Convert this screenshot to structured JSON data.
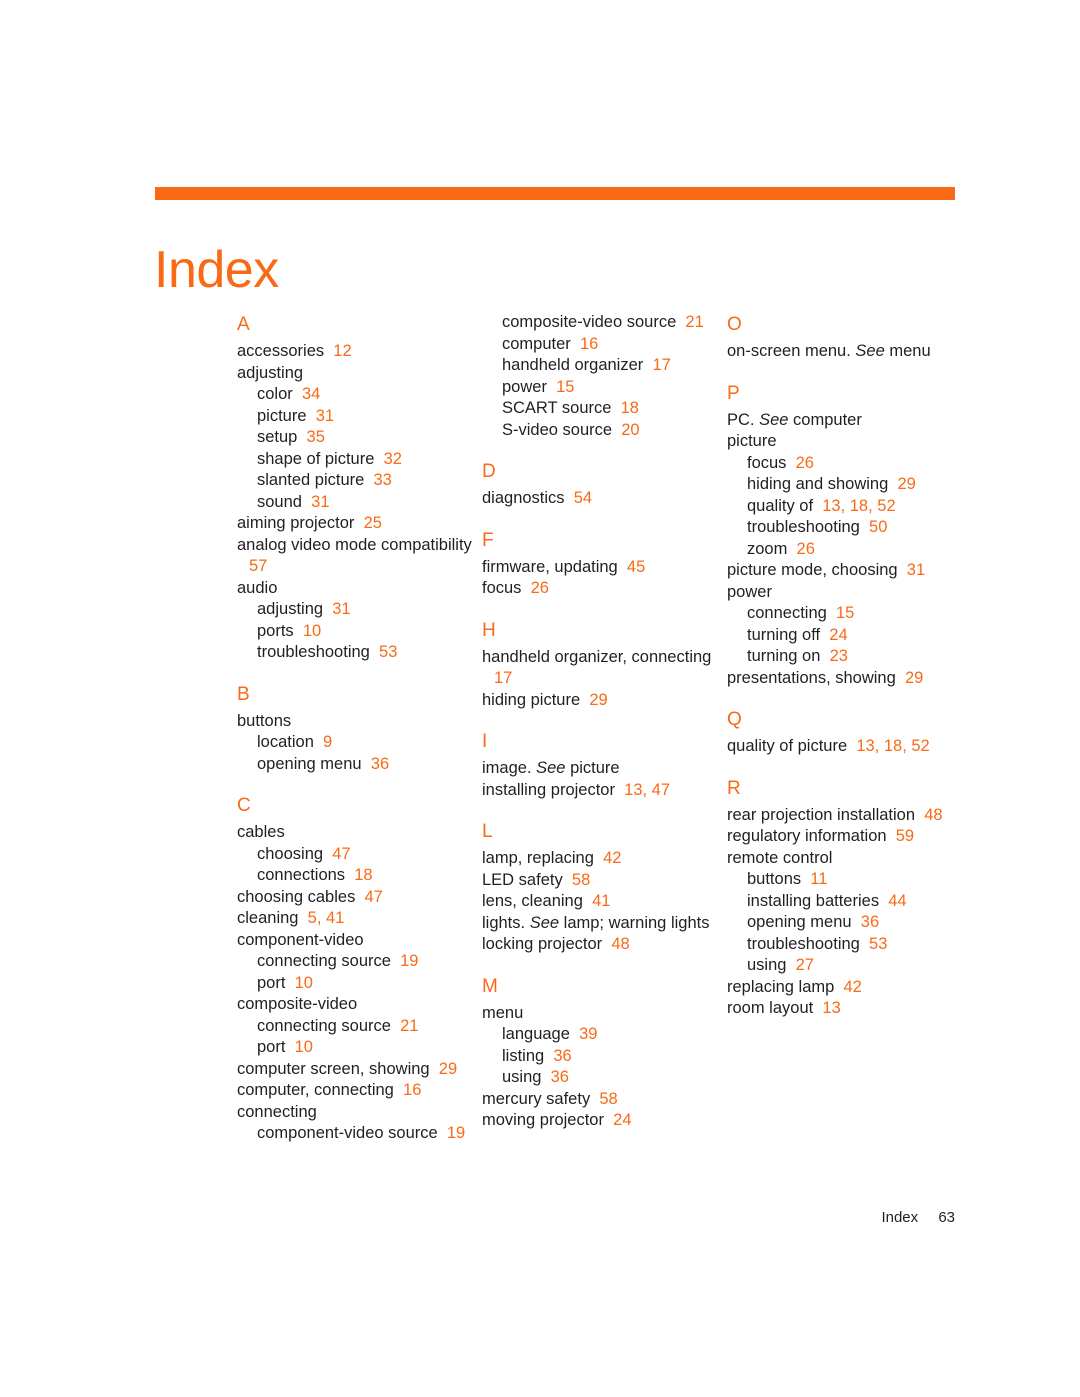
{
  "document": {
    "title": "Index",
    "accent_color": "#f96a16",
    "text_color": "#231f20",
    "footer": {
      "label": "Index",
      "page_number": "63"
    }
  },
  "columns": [
    {
      "id": "column-1",
      "blocks": [
        {
          "letter": "A",
          "entries": [
            {
              "level": 0,
              "text": "accessories",
              "pages": "12"
            },
            {
              "level": 0,
              "text": "adjusting",
              "pages": ""
            },
            {
              "level": 1,
              "text": "color",
              "pages": "34"
            },
            {
              "level": 1,
              "text": "picture",
              "pages": "31"
            },
            {
              "level": 1,
              "text": "setup",
              "pages": "35"
            },
            {
              "level": 1,
              "text": "shape of picture",
              "pages": "32"
            },
            {
              "level": 1,
              "text": "slanted picture",
              "pages": "33"
            },
            {
              "level": 1,
              "text": "sound",
              "pages": "31"
            },
            {
              "level": 0,
              "text": "aiming projector",
              "pages": "25"
            },
            {
              "level": 0,
              "text": "analog video mode compatibility",
              "pages": "57"
            },
            {
              "level": 0,
              "text": "audio",
              "pages": ""
            },
            {
              "level": 1,
              "text": "adjusting",
              "pages": "31"
            },
            {
              "level": 1,
              "text": "ports",
              "pages": "10"
            },
            {
              "level": 1,
              "text": "troubleshooting",
              "pages": "53"
            }
          ]
        },
        {
          "letter": "B",
          "entries": [
            {
              "level": 0,
              "text": "buttons",
              "pages": ""
            },
            {
              "level": 1,
              "text": "location",
              "pages": "9"
            },
            {
              "level": 1,
              "text": "opening menu",
              "pages": "36"
            }
          ]
        },
        {
          "letter": "C",
          "entries": [
            {
              "level": 0,
              "text": "cables",
              "pages": ""
            },
            {
              "level": 1,
              "text": "choosing",
              "pages": "47"
            },
            {
              "level": 1,
              "text": "connections",
              "pages": "18"
            },
            {
              "level": 0,
              "text": "choosing cables",
              "pages": "47"
            },
            {
              "level": 0,
              "text": "cleaning",
              "pages": "5, 41"
            },
            {
              "level": 0,
              "text": "component-video",
              "pages": ""
            },
            {
              "level": 1,
              "text": "connecting source",
              "pages": "19"
            },
            {
              "level": 1,
              "text": "port",
              "pages": "10"
            },
            {
              "level": 0,
              "text": "composite-video",
              "pages": ""
            },
            {
              "level": 1,
              "text": "connecting source",
              "pages": "21"
            },
            {
              "level": 1,
              "text": "port",
              "pages": "10"
            },
            {
              "level": 0,
              "text": "computer screen, showing",
              "pages": "29"
            },
            {
              "level": 0,
              "text": "computer, connecting",
              "pages": "16"
            },
            {
              "level": 0,
              "text": "connecting",
              "pages": ""
            },
            {
              "level": 1,
              "text": "component-video source",
              "pages": "19"
            }
          ]
        }
      ]
    },
    {
      "id": "column-2",
      "blocks": [
        {
          "letter": "",
          "entries": [
            {
              "level": 1,
              "text": "composite-video source",
              "pages": "21"
            },
            {
              "level": 1,
              "text": "computer",
              "pages": "16"
            },
            {
              "level": 1,
              "text": "handheld organizer",
              "pages": "17"
            },
            {
              "level": 1,
              "text": "power",
              "pages": "15"
            },
            {
              "level": 1,
              "text": "SCART source",
              "pages": "18"
            },
            {
              "level": 1,
              "text": "S-video source",
              "pages": "20"
            }
          ]
        },
        {
          "letter": "D",
          "entries": [
            {
              "level": 0,
              "text": "diagnostics",
              "pages": "54"
            }
          ]
        },
        {
          "letter": "F",
          "entries": [
            {
              "level": 0,
              "text": "firmware, updating",
              "pages": "45"
            },
            {
              "level": 0,
              "text": "focus",
              "pages": "26"
            }
          ]
        },
        {
          "letter": "H",
          "entries": [
            {
              "level": 0,
              "text": "handheld organizer, connecting",
              "pages": "17"
            },
            {
              "level": 0,
              "text": "hiding picture",
              "pages": "29"
            }
          ]
        },
        {
          "letter": "I",
          "entries": [
            {
              "level": 0,
              "text": "image.",
              "see": "See",
              "after_see": "picture",
              "pages": ""
            },
            {
              "level": 0,
              "text": "installing projector",
              "pages": "13, 47"
            }
          ]
        },
        {
          "letter": "L",
          "entries": [
            {
              "level": 0,
              "text": "lamp, replacing",
              "pages": "42"
            },
            {
              "level": 0,
              "text": "LED safety",
              "pages": "58"
            },
            {
              "level": 0,
              "text": "lens, cleaning",
              "pages": "41"
            },
            {
              "level": 0,
              "text": "lights.",
              "see": "See",
              "after_see": "lamp; warning lights",
              "pages": ""
            },
            {
              "level": 0,
              "text": "locking projector",
              "pages": "48"
            }
          ]
        },
        {
          "letter": "M",
          "entries": [
            {
              "level": 0,
              "text": "menu",
              "pages": ""
            },
            {
              "level": 1,
              "text": "language",
              "pages": "39"
            },
            {
              "level": 1,
              "text": "listing",
              "pages": "36"
            },
            {
              "level": 1,
              "text": "using",
              "pages": "36"
            },
            {
              "level": 0,
              "text": "mercury safety",
              "pages": "58"
            },
            {
              "level": 0,
              "text": "moving projector",
              "pages": "24"
            }
          ]
        }
      ]
    },
    {
      "id": "column-3",
      "blocks": [
        {
          "letter": "O",
          "entries": [
            {
              "level": 0,
              "text": "on-screen menu.",
              "see": "See",
              "after_see": "menu",
              "pages": ""
            }
          ]
        },
        {
          "letter": "P",
          "entries": [
            {
              "level": 0,
              "text": "PC.",
              "see": "See",
              "after_see": "computer",
              "pages": ""
            },
            {
              "level": 0,
              "text": "picture",
              "pages": ""
            },
            {
              "level": 1,
              "text": "focus",
              "pages": "26"
            },
            {
              "level": 1,
              "text": "hiding and showing",
              "pages": "29"
            },
            {
              "level": 1,
              "text": "quality of",
              "pages": "13, 18, 52"
            },
            {
              "level": 1,
              "text": "troubleshooting",
              "pages": "50"
            },
            {
              "level": 1,
              "text": "zoom",
              "pages": "26"
            },
            {
              "level": 0,
              "text": "picture mode, choosing",
              "pages": "31"
            },
            {
              "level": 0,
              "text": "power",
              "pages": ""
            },
            {
              "level": 1,
              "text": "connecting",
              "pages": "15"
            },
            {
              "level": 1,
              "text": "turning off",
              "pages": "24"
            },
            {
              "level": 1,
              "text": "turning on",
              "pages": "23"
            },
            {
              "level": 0,
              "text": "presentations, showing",
              "pages": "29"
            }
          ]
        },
        {
          "letter": "Q",
          "entries": [
            {
              "level": 0,
              "text": "quality of picture",
              "pages": "13, 18, 52"
            }
          ]
        },
        {
          "letter": "R",
          "entries": [
            {
              "level": 0,
              "text": "rear projection installation",
              "pages": "48"
            },
            {
              "level": 0,
              "text": "regulatory information",
              "pages": "59"
            },
            {
              "level": 0,
              "text": "remote control",
              "pages": ""
            },
            {
              "level": 1,
              "text": "buttons",
              "pages": "11"
            },
            {
              "level": 1,
              "text": "installing batteries",
              "pages": "44"
            },
            {
              "level": 1,
              "text": "opening menu",
              "pages": "36"
            },
            {
              "level": 1,
              "text": "troubleshooting",
              "pages": "53"
            },
            {
              "level": 1,
              "text": "using",
              "pages": "27"
            },
            {
              "level": 0,
              "text": "replacing lamp",
              "pages": "42"
            },
            {
              "level": 0,
              "text": "room layout",
              "pages": "13"
            }
          ]
        }
      ]
    }
  ]
}
